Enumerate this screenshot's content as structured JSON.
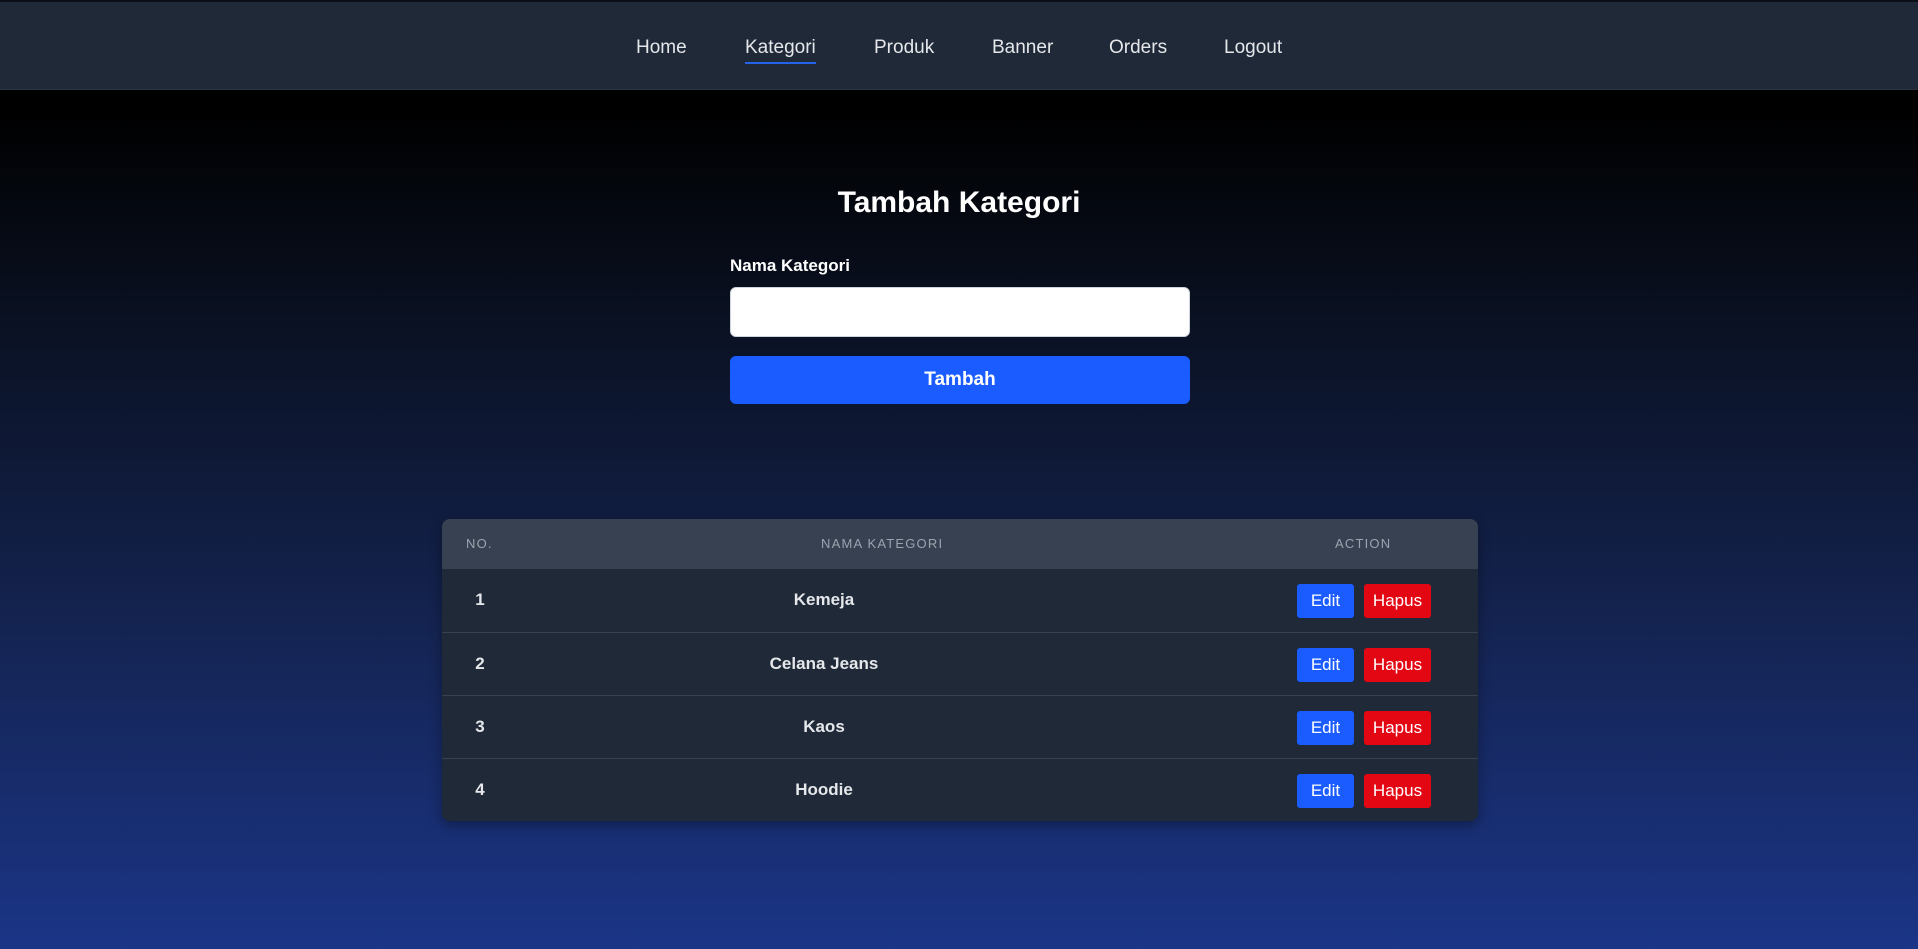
{
  "nav": {
    "items": [
      {
        "label": "Home"
      },
      {
        "label": "Kategori",
        "active": true
      },
      {
        "label": "Produk"
      },
      {
        "label": "Banner"
      },
      {
        "label": "Orders"
      },
      {
        "label": "Logout"
      }
    ]
  },
  "form": {
    "title": "Tambah Kategori",
    "field_label": "Nama Kategori",
    "field_value": "",
    "submit_label": "Tambah"
  },
  "table": {
    "headers": [
      "NO.",
      "NAMA KATEGORI",
      "ACTION"
    ],
    "rows": [
      {
        "no": "1",
        "name": "Kemeja",
        "edit": "Edit",
        "delete": "Hapus"
      },
      {
        "no": "2",
        "name": "Celana Jeans",
        "edit": "Edit",
        "delete": "Hapus"
      },
      {
        "no": "3",
        "name": "Kaos",
        "edit": "Edit",
        "delete": "Hapus"
      },
      {
        "no": "4",
        "name": "Hoodie",
        "edit": "Edit",
        "delete": "Hapus"
      }
    ]
  },
  "colors": {
    "navbar": "#1f2937",
    "primary": "#1a5cff",
    "danger": "#e30613",
    "table_header": "#374151",
    "table_body": "#1f2937"
  }
}
